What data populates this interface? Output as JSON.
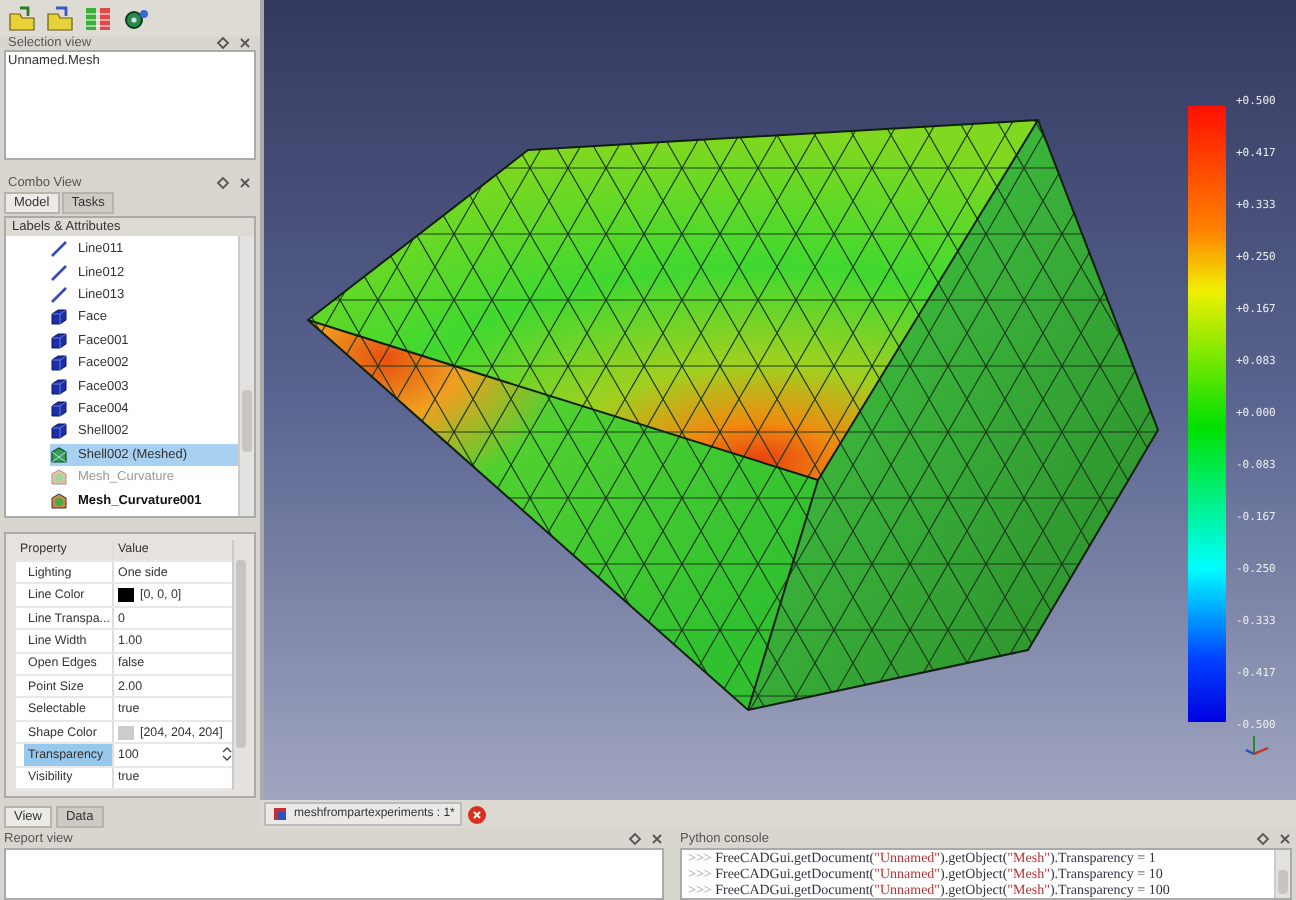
{
  "selection_view": {
    "title": "Selection view",
    "items": [
      "Unnamed.Mesh"
    ]
  },
  "combo_view": {
    "title": "Combo View",
    "tabs": [
      {
        "label": "Model",
        "selected": true
      },
      {
        "label": "Tasks",
        "selected": false
      }
    ],
    "tree": {
      "header": "Labels & Attributes",
      "items": [
        {
          "label": "Line011",
          "kind": "line",
          "selected": false,
          "greyed": false,
          "bold": false
        },
        {
          "label": "Line012",
          "kind": "line",
          "selected": false,
          "greyed": false,
          "bold": false
        },
        {
          "label": "Line013",
          "kind": "line",
          "selected": false,
          "greyed": false,
          "bold": false
        },
        {
          "label": "Face",
          "kind": "face",
          "selected": false,
          "greyed": false,
          "bold": false
        },
        {
          "label": "Face001",
          "kind": "face",
          "selected": false,
          "greyed": false,
          "bold": false
        },
        {
          "label": "Face002",
          "kind": "face",
          "selected": false,
          "greyed": false,
          "bold": false
        },
        {
          "label": "Face003",
          "kind": "face",
          "selected": false,
          "greyed": false,
          "bold": false
        },
        {
          "label": "Face004",
          "kind": "face",
          "selected": false,
          "greyed": false,
          "bold": false
        },
        {
          "label": "Shell002",
          "kind": "face",
          "selected": false,
          "greyed": false,
          "bold": false
        },
        {
          "label": "Shell002 (Meshed)",
          "kind": "mesh",
          "selected": true,
          "greyed": false,
          "bold": false
        },
        {
          "label": "Mesh_Curvature",
          "kind": "curvature",
          "selected": false,
          "greyed": true,
          "bold": false
        },
        {
          "label": "Mesh_Curvature001",
          "kind": "curvature",
          "selected": false,
          "greyed": false,
          "bold": true
        }
      ]
    },
    "properties": {
      "columns": [
        "Property",
        "Value"
      ],
      "rows": [
        {
          "name": "Lighting",
          "value": "One side",
          "selected": false
        },
        {
          "name": "Line Color",
          "value": "[0, 0, 0]",
          "color": "#000000",
          "selected": false
        },
        {
          "name": "Line Transpa...",
          "value": "0",
          "selected": false
        },
        {
          "name": "Line Width",
          "value": "1.00",
          "selected": false
        },
        {
          "name": "Open Edges",
          "value": "false",
          "selected": false
        },
        {
          "name": "Point Size",
          "value": "2.00",
          "selected": false
        },
        {
          "name": "Selectable",
          "value": "true",
          "selected": false
        },
        {
          "name": "Shape Color",
          "value": "[204, 204, 204]",
          "color": "#cccccc",
          "selected": false
        },
        {
          "name": "Transparency",
          "value": "100",
          "selected": true,
          "spin": true
        },
        {
          "name": "Visibility",
          "value": "true",
          "selected": false
        }
      ]
    },
    "bottom_tabs": [
      {
        "label": "View",
        "selected": true
      },
      {
        "label": "Data",
        "selected": false
      }
    ]
  },
  "viewport": {
    "scale_labels": [
      "+0.500",
      "+0.417",
      "+0.333",
      "+0.250",
      "+0.167",
      "+0.083",
      "+0.000",
      "-0.083",
      "-0.167",
      "-0.250",
      "-0.333",
      "-0.417",
      "-0.500"
    ]
  },
  "document_tabs": [
    {
      "label": "meshfrompartexperiments : 1*"
    }
  ],
  "report_view": {
    "title": "Report view"
  },
  "python_console": {
    "title": "Python console",
    "lines": [
      {
        "prompt": ">>>",
        "code": "FreeCADGui.getDocument(**\"Unnamed\"**).getObject(**\"Mesh\"**).Transparency = 1"
      },
      {
        "prompt": ">>>",
        "code": "FreeCADGui.getDocument(**\"Unnamed\"**).getObject(**\"Mesh\"**).Transparency = 10"
      },
      {
        "prompt": ">>>",
        "code": "FreeCADGui.getDocument(**\"Unnamed\"**).getObject(**\"Mesh\"**).Transparency = 100"
      }
    ]
  }
}
